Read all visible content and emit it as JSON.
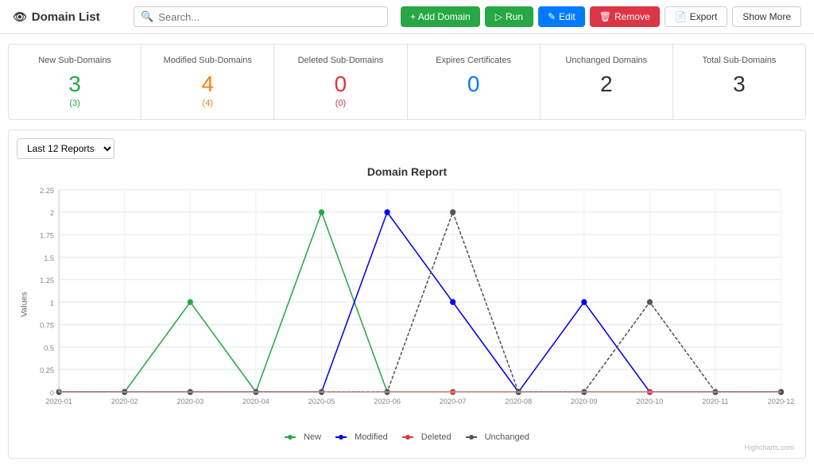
{
  "header": {
    "title": "Domain List",
    "search_placeholder": "Search...",
    "buttons": {
      "add": "+ Add Domain",
      "run": "Run",
      "edit": "Edit",
      "remove": "Remove",
      "export": "Export",
      "show_more": "Show More"
    }
  },
  "stats": [
    {
      "label": "New Sub-Domains",
      "value": "3",
      "sub": "(3)",
      "color": "green"
    },
    {
      "label": "Modified Sub-Domains",
      "value": "4",
      "sub": "(4)",
      "color": "orange"
    },
    {
      "label": "Deleted Sub-Domains",
      "value": "0",
      "sub": "(0)",
      "color": "red"
    },
    {
      "label": "Expires Certificates",
      "value": "0",
      "sub": "",
      "color": "blue"
    },
    {
      "label": "Unchanged Domains",
      "value": "2",
      "sub": "",
      "color": "dark"
    },
    {
      "label": "Total Sub-Domains",
      "value": "3",
      "sub": "",
      "color": "dark"
    }
  ],
  "chart": {
    "filter_label": "Last 12 Reports",
    "title": "Domain Report",
    "y_axis_label": "Values",
    "x_labels": [
      "2020-01",
      "2020-02",
      "2020-03",
      "2020-04",
      "2020-05",
      "2020-06",
      "2020-07",
      "2020-08",
      "2020-09",
      "2020-10",
      "2020-11",
      "2020-12"
    ],
    "y_ticks": [
      "0",
      "0.25",
      "0.5",
      "0.75",
      "1",
      "1.25",
      "1.5",
      "1.75",
      "2",
      "2.25"
    ],
    "legend": [
      {
        "label": "New",
        "color": "#28a745"
      },
      {
        "label": "Modified",
        "color": "#0000ff"
      },
      {
        "label": "Deleted",
        "color": "#dc3545"
      },
      {
        "label": "Unchanged",
        "color": "#555"
      }
    ],
    "series": {
      "new": [
        0,
        0,
        1,
        0,
        2,
        0,
        0,
        0,
        0,
        0,
        0,
        0
      ],
      "modified": [
        0,
        0,
        0,
        0,
        0,
        2,
        1,
        0,
        1,
        0,
        0,
        0
      ],
      "deleted": [
        0,
        0,
        0,
        0,
        0,
        0,
        0,
        0,
        0,
        0,
        0,
        0
      ],
      "unchanged": [
        0,
        0,
        0,
        0,
        0,
        0,
        2,
        0,
        0,
        1,
        0,
        0
      ]
    },
    "credit": "Highcharts.com"
  }
}
